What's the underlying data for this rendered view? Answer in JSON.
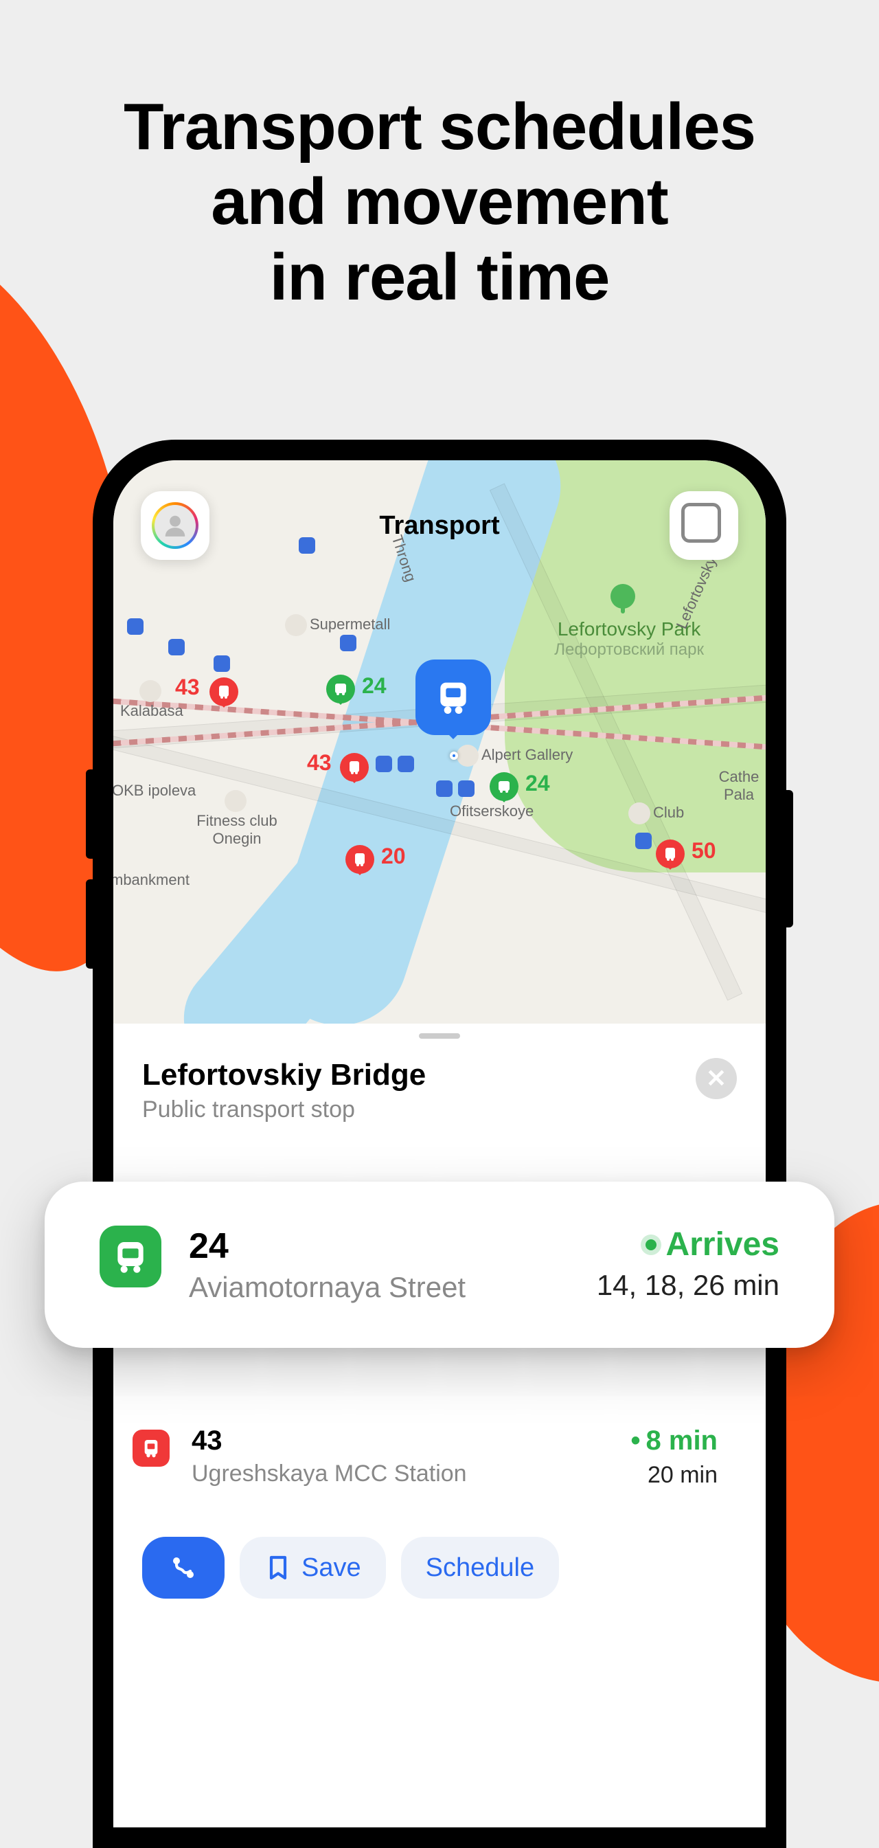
{
  "heading_line1": "Transport schedules",
  "heading_line2": "and movement",
  "heading_line3": "in real time",
  "map": {
    "header_title": "Transport",
    "park_name": "Lefortovsky Park",
    "park_sub": "Лефортовский парк",
    "pois": {
      "supermetall": "Supermetall",
      "kalabasa": "Kalabasa",
      "okb": "OKB ipoleva",
      "fitness": "Fitness club Onegin",
      "alpert": "Alpert Gallery",
      "ofitserskoye": "Ofitserskoye",
      "club": "Club",
      "cathe": "Cathe Pala",
      "tunnel": "Lefortovsky Tunnel",
      "embankment": "mbankment",
      "throng": "Throng"
    },
    "vehicles": [
      {
        "id": "43a",
        "label": "43",
        "type": "tram",
        "color": "red"
      },
      {
        "id": "24a",
        "label": "24",
        "type": "bus",
        "color": "green"
      },
      {
        "id": "43b",
        "label": "43",
        "type": "tram",
        "color": "red"
      },
      {
        "id": "24b",
        "label": "24",
        "type": "bus",
        "color": "green"
      },
      {
        "id": "20",
        "label": "20",
        "type": "tram",
        "color": "red"
      },
      {
        "id": "50",
        "label": "50",
        "type": "tram",
        "color": "red"
      }
    ]
  },
  "stop": {
    "title": "Lefortovskiy Bridge",
    "subtitle": "Public transport stop"
  },
  "routes": [
    {
      "number": "24",
      "destination": "Aviamotornaya Street",
      "status": "Arrives",
      "times": "14, 18, 26 min",
      "type": "bus"
    },
    {
      "number": "43",
      "destination": "Ugreshskaya MCC Station",
      "next": "8 min",
      "later": "20 min",
      "type": "tram"
    }
  ],
  "actions": {
    "save": "Save",
    "schedule": "Schedule"
  }
}
